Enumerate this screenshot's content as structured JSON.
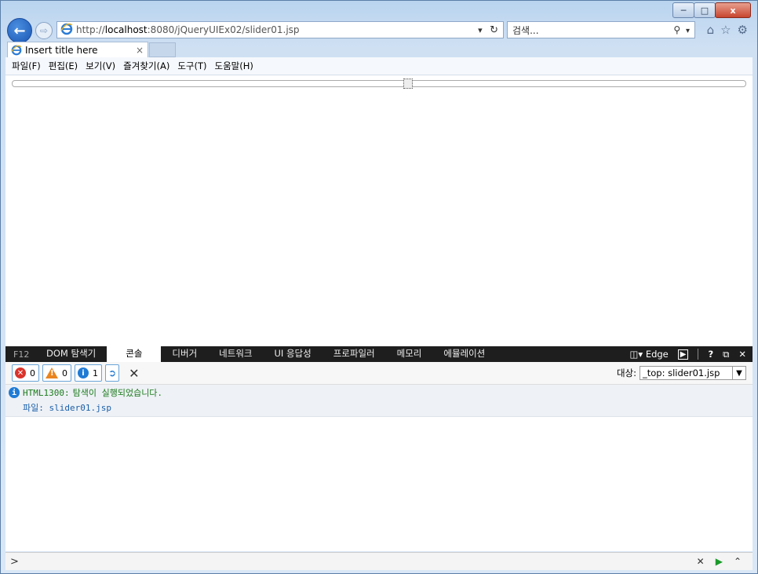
{
  "window": {
    "caption": {
      "minimize": "─",
      "maximize": "□",
      "close": "x"
    }
  },
  "nav": {
    "url_prefix": "http://",
    "url_host": "localhost",
    "url_rest": ":8080/jQueryUIEx02/slider01.jsp",
    "search_placeholder": "검색...",
    "icons": [
      "back-icon",
      "forward-icon",
      "ie-logo-icon",
      "refresh-icon",
      "search-icon",
      "home-icon",
      "favorites-star-icon",
      "settings-gear-icon"
    ]
  },
  "tab": {
    "title": "Insert title here",
    "close": "×"
  },
  "menu": [
    "파일(F)",
    "편집(E)",
    "보기(V)",
    "즐겨찾기(A)",
    "도구(T)",
    "도움말(H)"
  ],
  "slider": {
    "value_fraction": 0.54
  },
  "devtools": {
    "f12": "F12",
    "tabs": [
      "DOM 탐색기",
      "콘솔",
      "디버거",
      "네트워크",
      "UI 응답성",
      "프로파일러",
      "메모리",
      "에뮬레이션"
    ],
    "active_tab": "콘솔",
    "mode": "Edge",
    "help": "?",
    "close": "✕",
    "filters": {
      "errors": "0",
      "warnings": "0",
      "info": "1"
    },
    "target_label": "대상:",
    "target_value": "_top: slider01.jsp",
    "message": {
      "code": "HTML1300:",
      "text": "탐색이 실행되었습니다.",
      "file_label": "파일:",
      "file": "slider01.jsp"
    },
    "prompt": ">",
    "colors": {
      "error": "#d9342b",
      "warning": "#e98520",
      "info": "#1f7bd4"
    }
  }
}
